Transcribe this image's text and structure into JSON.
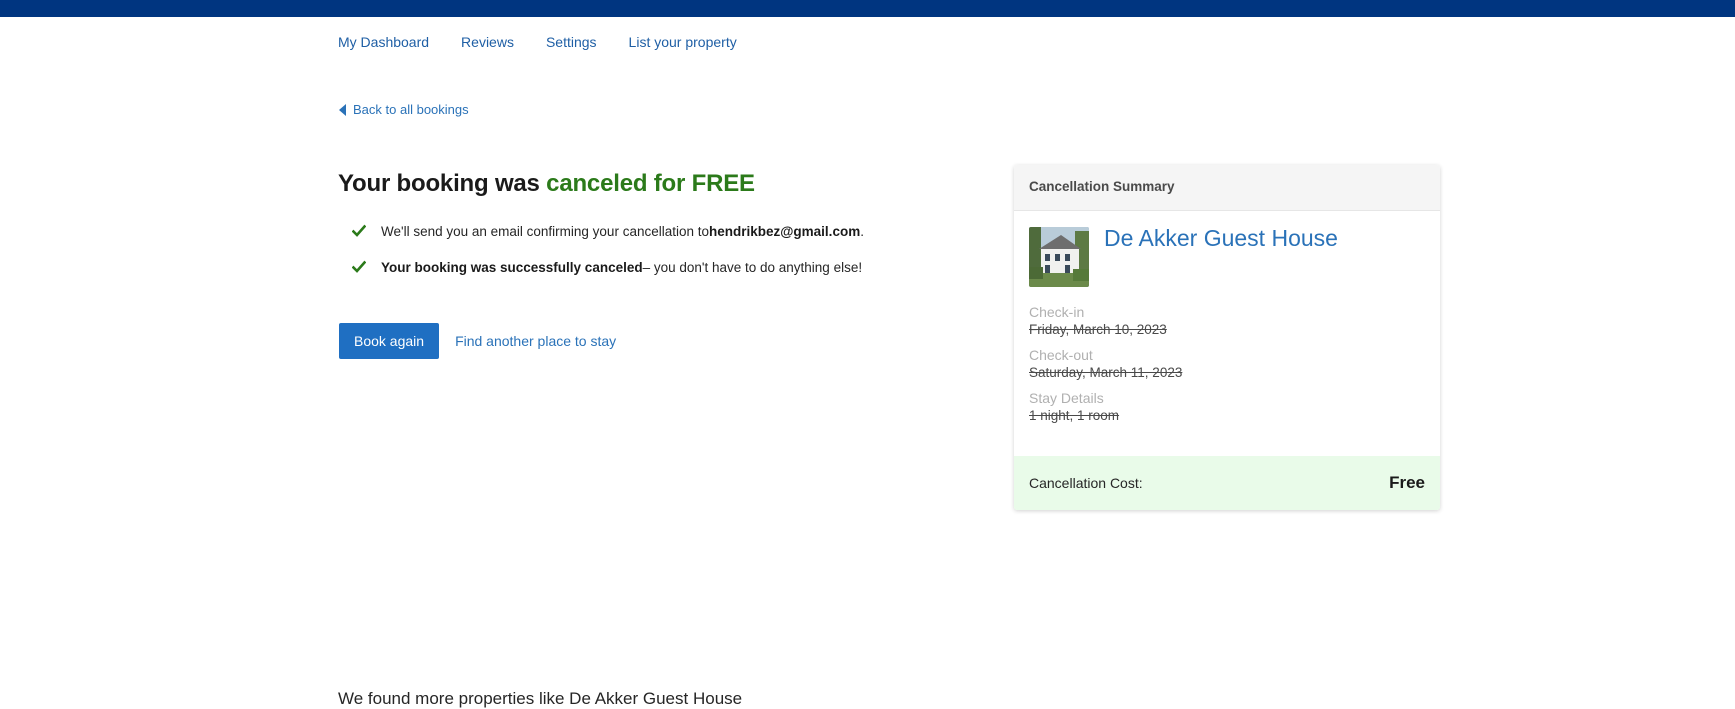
{
  "nav": {
    "items": [
      "My Dashboard",
      "Reviews",
      "Settings",
      "List your property"
    ]
  },
  "back_link": "Back to all bookings",
  "headline": {
    "prefix": "Your booking was ",
    "highlight": "canceled for FREE"
  },
  "checks": [
    {
      "text_before": "We'll send you an email confirming your cancellation to ",
      "bold": "hendrikbez@gmail.com",
      "text_after": "."
    },
    {
      "text_before": "",
      "bold": "Your booking was successfully canceled",
      "text_after": " – you don't have to do anything else!"
    }
  ],
  "actions": {
    "book_again": "Book again",
    "find_another": "Find another place to stay"
  },
  "summary": {
    "header": "Cancellation Summary",
    "hotel_name": "De Akker Guest House",
    "checkin_label": "Check-in",
    "checkin_value": "Friday, March 10, 2023",
    "checkout_label": "Check-out",
    "checkout_value": "Saturday, March 11, 2023",
    "stay_label": "Stay Details",
    "stay_value": "1 night, 1 room",
    "cost_label": "Cancellation Cost:",
    "cost_value": "Free"
  },
  "more_properties": "We found more properties like De Akker Guest House",
  "colors": {
    "top_bar": "#003580",
    "link": "#2a72b8",
    "success_green": "#2b7a1a",
    "primary_button": "#1f6fc2",
    "cost_background": "#e9fbe9"
  },
  "icons": {
    "back": "caret-left-icon",
    "check": "checkmark-icon"
  }
}
